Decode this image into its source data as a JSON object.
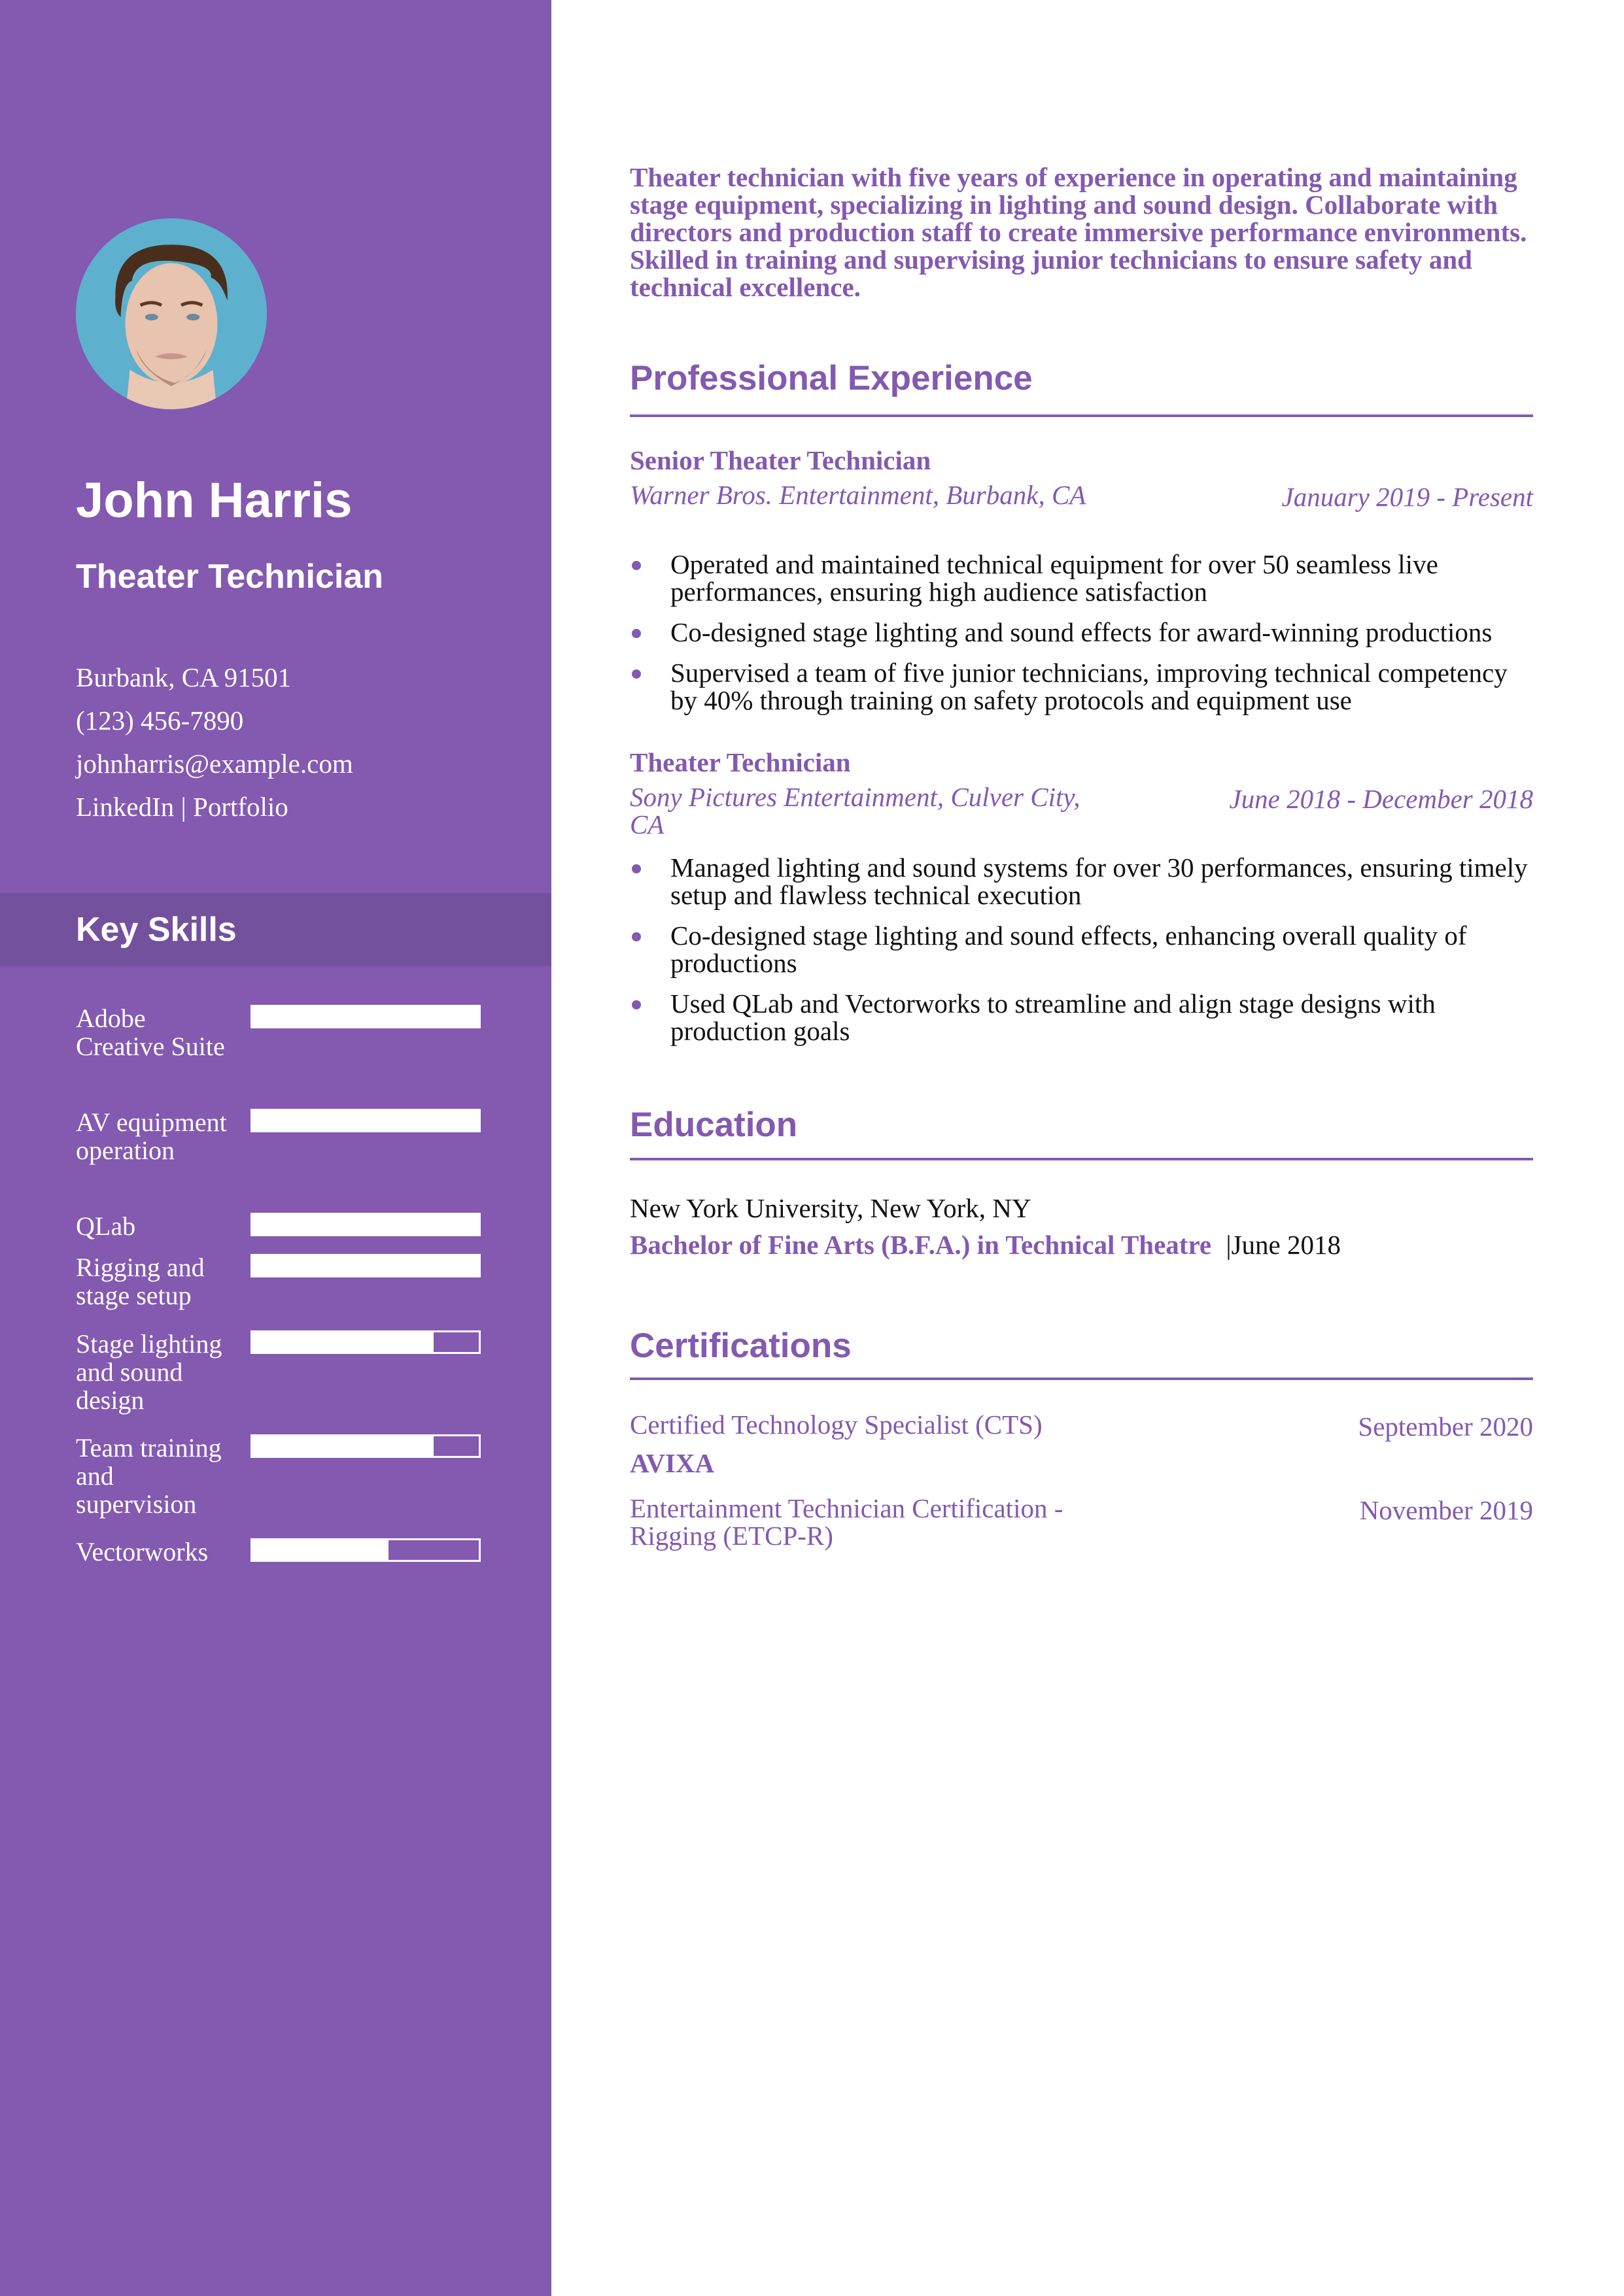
{
  "theme": {
    "accent": "#8459b0",
    "accent_dark": "#74519c",
    "text": "#111111",
    "background": "#ffffff"
  },
  "profile": {
    "photo_alt": "portrait-photo",
    "name": "John Harris",
    "title": "Theater Technician"
  },
  "contact": {
    "location": "Burbank, CA 91501",
    "phone": "(123) 456-7890",
    "email": "johnharris@example.com",
    "linkedin": "LinkedIn",
    "separator": "|",
    "portfolio": "Portfolio"
  },
  "skills": {
    "heading": "Key Skills",
    "items": [
      {
        "label": "Adobe Creative Suite",
        "level": 1.0
      },
      {
        "label": "AV equipment operation",
        "level": 1.0
      },
      {
        "label": "QLab",
        "level": 1.0
      },
      {
        "label": "Rigging and stage setup",
        "level": 1.0
      },
      {
        "label": "Stage lighting and sound design",
        "level": 0.8
      },
      {
        "label": "Team training and supervision",
        "level": 0.8
      },
      {
        "label": "Vectorworks",
        "level": 0.6
      }
    ]
  },
  "summary": "Theater technician with five years of experience in operating and maintaining stage equipment, specializing in lighting and sound design. Collaborate with directors and production staff to create immersive performance environments. Skilled in training and supervising junior technicians to ensure safety and technical excellence.",
  "experience": {
    "heading": "Professional Experience",
    "jobs": [
      {
        "title": "Senior Theater Technician",
        "company": "Warner Bros. Entertainment, Burbank, CA",
        "dates": "January 2019 - Present",
        "bullets": [
          "Operated and maintained technical equipment for over 50 seamless live performances, ensuring high audience satisfaction",
          "Co-designed stage lighting and sound effects for award-winning productions",
          "Supervised a team of five junior technicians, improving technical competency by 40% through training on safety protocols and equipment use"
        ]
      },
      {
        "title": "Theater Technician",
        "company": "Sony Pictures Entertainment, Culver City, CA",
        "dates": "June 2018 - December 2018",
        "bullets": [
          "Managed lighting and sound systems for over 30 performances, ensuring timely setup and flawless technical execution",
          "Co-designed stage lighting and sound effects, enhancing overall quality of productions",
          "Used QLab and Vectorworks to streamline and align stage designs with production goals"
        ]
      }
    ]
  },
  "education": {
    "heading": "Education",
    "school": "New York University, New York, NY",
    "degree": "Bachelor of Fine Arts (B.F.A.) in Technical Theatre",
    "separator": "|",
    "date": "June 2018"
  },
  "certifications": {
    "heading": "Certifications",
    "items": [
      {
        "name": "Certified Technology Specialist (CTS)",
        "date": "September 2020",
        "org": "AVIXA"
      },
      {
        "name": "Entertainment Technician Certification - Rigging (ETCP-R)",
        "date": "November 2019"
      }
    ]
  }
}
